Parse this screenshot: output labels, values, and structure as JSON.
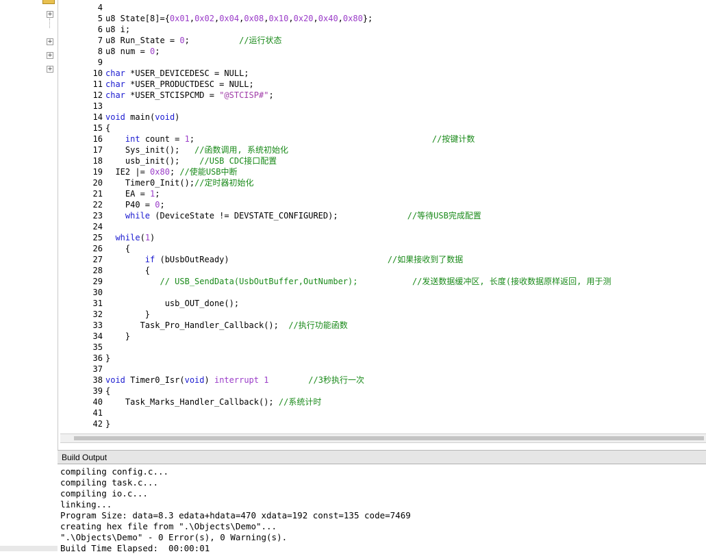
{
  "editor": {
    "lines": [
      {
        "n": "4",
        "segs": []
      },
      {
        "n": "5",
        "segs": [
          [
            "u8 State[8]={",
            "p"
          ],
          [
            "0x01",
            "num"
          ],
          [
            ",",
            "p"
          ],
          [
            "0x02",
            "num"
          ],
          [
            ",",
            "p"
          ],
          [
            "0x04",
            "num"
          ],
          [
            ",",
            "p"
          ],
          [
            "0x08",
            "num"
          ],
          [
            ",",
            "p"
          ],
          [
            "0x10",
            "num"
          ],
          [
            ",",
            "p"
          ],
          [
            "0x20",
            "num"
          ],
          [
            ",",
            "p"
          ],
          [
            "0x40",
            "num"
          ],
          [
            ",",
            "p"
          ],
          [
            "0x80",
            "num"
          ],
          [
            "};",
            "p"
          ]
        ]
      },
      {
        "n": "6",
        "segs": [
          [
            "u8 i;",
            "p"
          ]
        ]
      },
      {
        "n": "7",
        "segs": [
          [
            "u8 Run_State = ",
            "p"
          ],
          [
            "0",
            "num"
          ],
          [
            ";          ",
            "p"
          ],
          [
            "//运行状态",
            "cmt"
          ]
        ]
      },
      {
        "n": "8",
        "segs": [
          [
            "u8 num = ",
            "p"
          ],
          [
            "0",
            "num"
          ],
          [
            ";",
            "p"
          ]
        ]
      },
      {
        "n": "9",
        "segs": []
      },
      {
        "n": "10",
        "segs": [
          [
            "char",
            "kw"
          ],
          [
            " *USER_DEVICEDESC = NULL;",
            "p"
          ]
        ]
      },
      {
        "n": "11",
        "segs": [
          [
            "char",
            "kw"
          ],
          [
            " *USER_PRODUCTDESC = NULL;",
            "p"
          ]
        ]
      },
      {
        "n": "12",
        "segs": [
          [
            "char",
            "kw"
          ],
          [
            " *USER_STCISPCMD = ",
            "p"
          ],
          [
            "\"@STCISP#\"",
            "str"
          ],
          [
            ";",
            "p"
          ]
        ]
      },
      {
        "n": "13",
        "segs": []
      },
      {
        "n": "14",
        "segs": [
          [
            "void",
            "kw"
          ],
          [
            " main(",
            "p"
          ],
          [
            "void",
            "kw"
          ],
          [
            ")",
            "p"
          ]
        ]
      },
      {
        "n": "15",
        "segs": [
          [
            "{",
            "p"
          ]
        ]
      },
      {
        "n": "16",
        "segs": [
          [
            "    ",
            "p"
          ],
          [
            "int",
            "kw"
          ],
          [
            " count = ",
            "p"
          ],
          [
            "1",
            "num"
          ],
          [
            ";                                                ",
            "p"
          ],
          [
            "//按键计数",
            "cmt"
          ]
        ]
      },
      {
        "n": "17",
        "segs": [
          [
            "    Sys_init();   ",
            "p"
          ],
          [
            "//函数调用, 系统初始化",
            "cmt"
          ]
        ]
      },
      {
        "n": "18",
        "segs": [
          [
            "    usb_init();    ",
            "p"
          ],
          [
            "//USB CDC接口配置",
            "cmt"
          ]
        ]
      },
      {
        "n": "19",
        "segs": [
          [
            "  IE2 |= ",
            "p"
          ],
          [
            "0x80",
            "num"
          ],
          [
            "; ",
            "p"
          ],
          [
            "//使能USB中断",
            "cmt"
          ]
        ]
      },
      {
        "n": "20",
        "segs": [
          [
            "    Timer0_Init();",
            "p"
          ],
          [
            "//定时器初始化",
            "cmt"
          ]
        ]
      },
      {
        "n": "21",
        "segs": [
          [
            "    EA = ",
            "p"
          ],
          [
            "1",
            "num"
          ],
          [
            ";",
            "p"
          ]
        ]
      },
      {
        "n": "22",
        "segs": [
          [
            "    P40 = ",
            "p"
          ],
          [
            "0",
            "num"
          ],
          [
            ";",
            "p"
          ]
        ]
      },
      {
        "n": "23",
        "segs": [
          [
            "    ",
            "p"
          ],
          [
            "while",
            "kw"
          ],
          [
            " (DeviceState != DEVSTATE_CONFIGURED);              ",
            "p"
          ],
          [
            "//等待USB完成配置",
            "cmt"
          ]
        ]
      },
      {
        "n": "24",
        "segs": []
      },
      {
        "n": "25",
        "segs": [
          [
            "  ",
            "p"
          ],
          [
            "while",
            "kw"
          ],
          [
            "(",
            "p"
          ],
          [
            "1",
            "num"
          ],
          [
            ")",
            "p"
          ]
        ]
      },
      {
        "n": "26",
        "segs": [
          [
            "    {",
            "p"
          ]
        ]
      },
      {
        "n": "27",
        "segs": [
          [
            "        ",
            "p"
          ],
          [
            "if",
            "kw"
          ],
          [
            " (bUsbOutReady)                                ",
            "p"
          ],
          [
            "//如果接收到了数据",
            "cmt"
          ]
        ]
      },
      {
        "n": "28",
        "segs": [
          [
            "        {",
            "p"
          ]
        ]
      },
      {
        "n": "29",
        "segs": [
          [
            "           ",
            "p"
          ],
          [
            "// USB_SendData(UsbOutBuffer,OutNumber);           //发送数据缓冲区, 长度(接收数据原样返回, 用于测",
            "cmt"
          ]
        ]
      },
      {
        "n": "30",
        "segs": []
      },
      {
        "n": "31",
        "segs": [
          [
            "            usb_OUT_done();",
            "p"
          ]
        ]
      },
      {
        "n": "32",
        "segs": [
          [
            "        }",
            "p"
          ]
        ]
      },
      {
        "n": "33",
        "segs": [
          [
            "       Task_Pro_Handler_Callback();  ",
            "p"
          ],
          [
            "//执行功能函数",
            "cmt"
          ]
        ]
      },
      {
        "n": "34",
        "segs": [
          [
            "    }",
            "p"
          ]
        ]
      },
      {
        "n": "35",
        "segs": []
      },
      {
        "n": "36",
        "segs": [
          [
            "}",
            "p"
          ]
        ]
      },
      {
        "n": "37",
        "segs": []
      },
      {
        "n": "38",
        "segs": [
          [
            "void",
            "kw"
          ],
          [
            " Timer0_Isr(",
            "p"
          ],
          [
            "void",
            "kw"
          ],
          [
            ") ",
            "p"
          ],
          [
            "interrupt",
            "num"
          ],
          [
            " ",
            "p"
          ],
          [
            "1",
            "num"
          ],
          [
            "        ",
            "p"
          ],
          [
            "//3秒执行一次",
            "cmt"
          ]
        ]
      },
      {
        "n": "39",
        "segs": [
          [
            "{",
            "p"
          ]
        ]
      },
      {
        "n": "40",
        "segs": [
          [
            "    Task_Marks_Handler_Callback(); ",
            "p"
          ],
          [
            "//系统计时",
            "cmt"
          ]
        ]
      },
      {
        "n": "41",
        "segs": []
      },
      {
        "n": "42",
        "segs": [
          [
            "}",
            "p"
          ]
        ]
      }
    ]
  },
  "build_output": {
    "title": "Build Output",
    "lines": [
      "compiling config.c...",
      "compiling task.c...",
      "compiling io.c...",
      "linking...",
      "Program Size: data=8.3 edata+hdata=470 xdata=192 const=135 code=7469",
      "creating hex file from \".\\Objects\\Demo\"...",
      "\".\\Objects\\Demo\" - 0 Error(s), 0 Warning(s).",
      "Build Time Elapsed:  00:00:01"
    ]
  },
  "colors": {
    "keyword": "#1a1ad0",
    "number": "#9a3cc8",
    "string": "#a03ca8",
    "comment": "#1a8a1a"
  },
  "project_tree": {
    "expand_icons": [
      "plus-icon",
      "plus-icon",
      "plus-icon",
      "plus-icon"
    ]
  }
}
